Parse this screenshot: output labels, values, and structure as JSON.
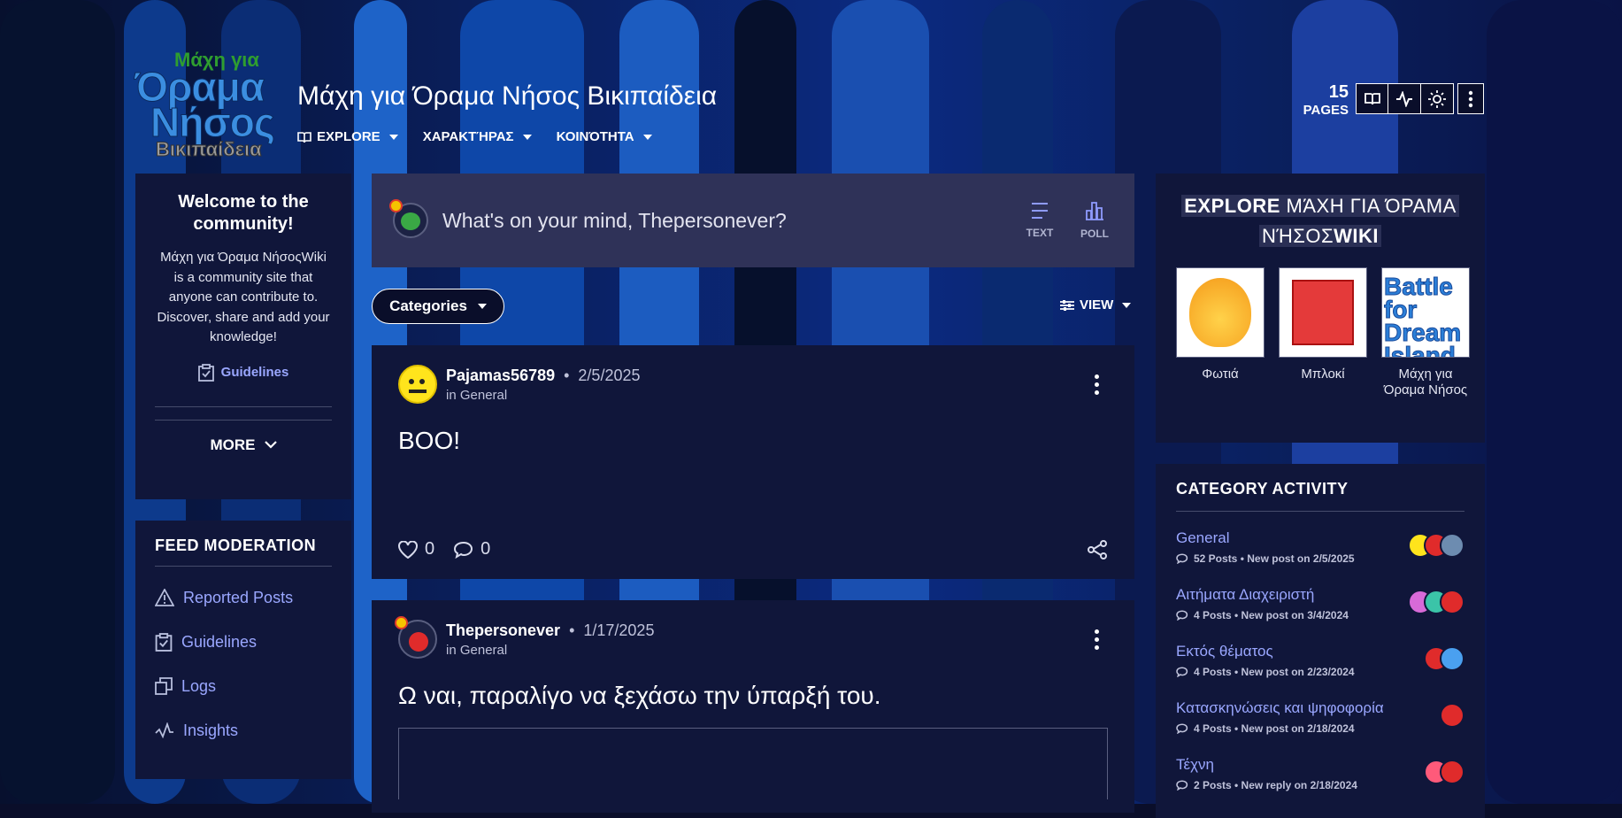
{
  "site": {
    "logo_line1": "Μάχη για",
    "logo_line2": "Όραμα",
    "logo_line3": "Νήσος",
    "logo_line4": "Βικιπαίδεια",
    "title": "Μάχη για Όραμα Νήσος Βικιπαίδεια",
    "pages_count": "15",
    "pages_label": "PAGES"
  },
  "nav": [
    {
      "label": "EXPLORE",
      "icon": "book-icon"
    },
    {
      "label": "ΧΑΡΑΚΤΉΡΑΣ"
    },
    {
      "label": "ΚΟΙΝΌΤΗΤΑ"
    }
  ],
  "welcome": {
    "title": "Welcome to the community!",
    "body": "Μάχη για Όραμα ΝήσοςWiki is a community site that anyone can contribute to. Discover, share and add your knowledge!",
    "guidelines": "Guidelines",
    "more": "MORE"
  },
  "feed_moderation": {
    "title": "FEED MODERATION",
    "items": [
      "Reported Posts",
      "Guidelines",
      "Logs",
      "Insights"
    ]
  },
  "composer": {
    "placeholder": "What's on your mind, Thepersonever?",
    "text_label": "TEXT",
    "poll_label": "POLL"
  },
  "filters": {
    "categories": "Categories",
    "view": "VIEW"
  },
  "posts": [
    {
      "author": "Pajamas56789",
      "date": "2/5/2025",
      "category": "in General",
      "body": "BOO!",
      "likes": "0",
      "comments": "0"
    },
    {
      "author": "Thepersonever",
      "date": "1/17/2025",
      "category": "in General",
      "body": "Ω ναι, παραλίγο να ξεχάσω την ύπαρξή του."
    }
  ],
  "explore": {
    "title_bold": "EXPLORE",
    "title_rest": " ΜΆΧΗ ΓΙΑ ΌΡΑΜΑ",
    "title_line2": "ΝΉΣΟΣ",
    "title_line2_bold": "WIKI",
    "tiles": [
      {
        "label": "Φωτιά"
      },
      {
        "label": "Μπλοκί"
      },
      {
        "label": "Μάχη για Όραμα Νήσος",
        "img_text": "Battle for Dream Island"
      }
    ]
  },
  "category_activity": {
    "title": "CATEGORY ACTIVITY",
    "rows": [
      {
        "name": "General",
        "stats": "52 Posts • New post on 2/5/2025"
      },
      {
        "name": "Αιτήματα Διαχειριστή",
        "stats": "4 Posts • New post on 3/4/2024"
      },
      {
        "name": "Εκτός θέματος",
        "stats": "4 Posts • New post on 2/23/2024"
      },
      {
        "name": "Κατασκηνώσεις και ψηφοφορία",
        "stats": "4 Posts • New post on 2/18/2024"
      },
      {
        "name": "Τέχνη",
        "stats": "2 Posts • New reply on 2/18/2024"
      }
    ]
  }
}
